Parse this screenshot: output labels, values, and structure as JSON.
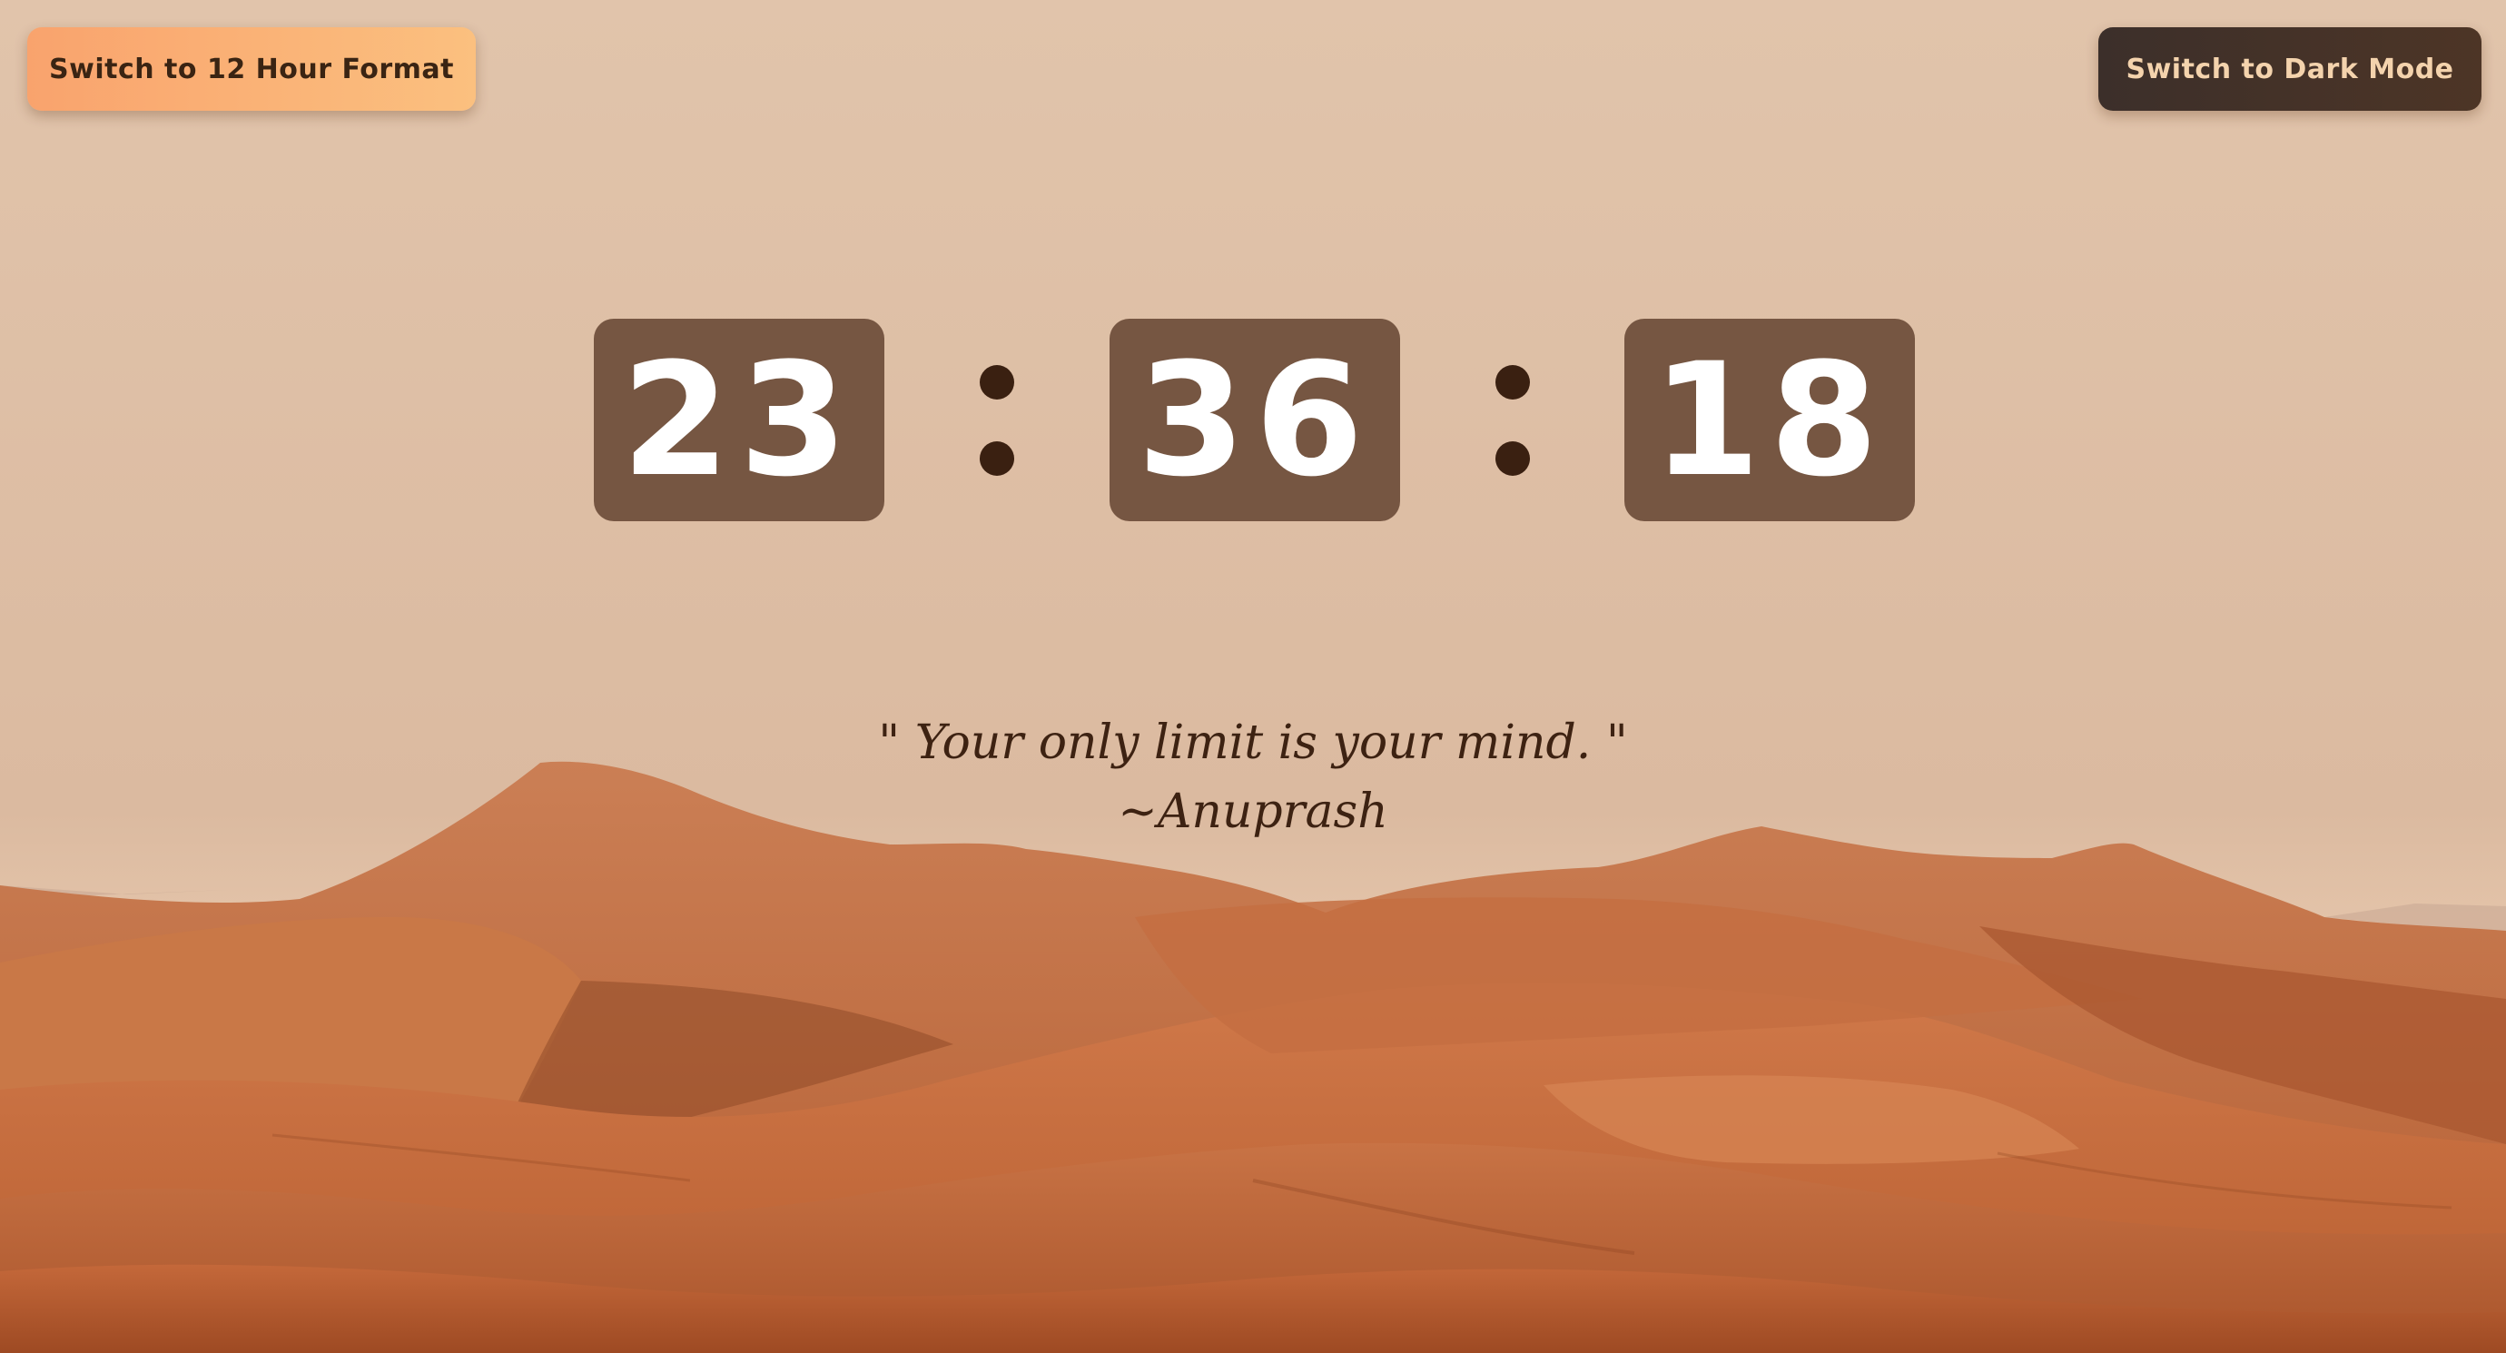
{
  "buttons": {
    "format_toggle": "Switch to 12 Hour Format",
    "theme_toggle": "Switch to Dark Mode"
  },
  "clock": {
    "hours": "23",
    "minutes": "36",
    "seconds": "18"
  },
  "quote": {
    "text": "\" Your only limit is your mind. \"",
    "author": "~Anuprash"
  },
  "colors": {
    "format_button": "#fbb374",
    "dark_mode_button": "#433129",
    "digit_box": "#6e4e3a",
    "separator": "#3a2011",
    "sky": "#e0c3aa",
    "dunes": "#c2693a"
  },
  "background": "desert-dunes-image"
}
